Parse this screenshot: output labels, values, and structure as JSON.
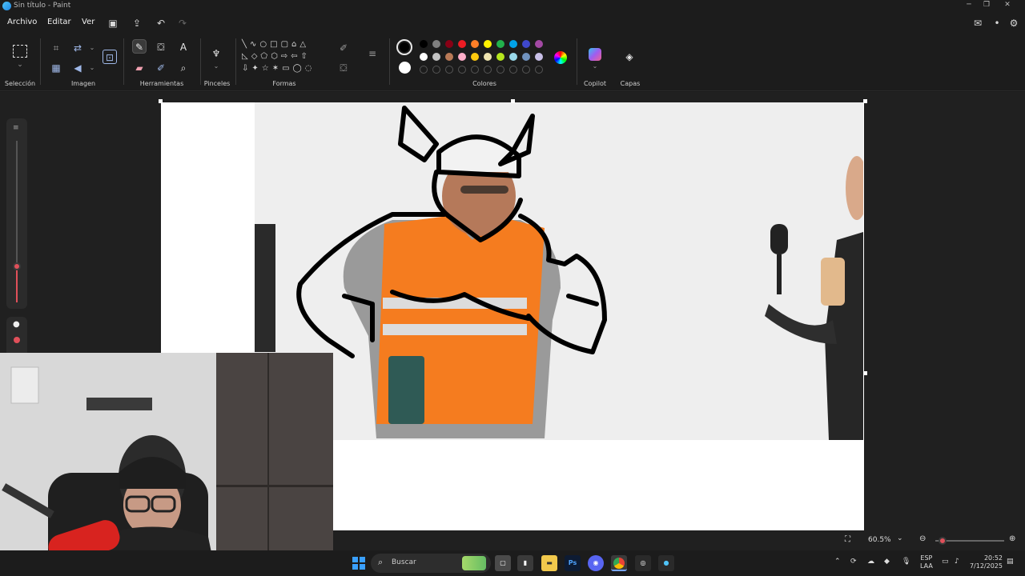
{
  "window": {
    "title": "Sin título - Paint"
  },
  "menu": {
    "items": [
      "Archivo",
      "Editar",
      "Ver"
    ]
  },
  "toolbar": {
    "groups": {
      "selection": "Selección",
      "image": "Imagen",
      "tools": "Herramientas",
      "brushes": "Pinceles",
      "shapes": "Formas",
      "colors": "Colores",
      "copilot": "Copilot",
      "layers": "Capas"
    },
    "palette_row1": [
      "#000000",
      "#7f7f7f",
      "#880015",
      "#ed1c24",
      "#ff7f27",
      "#fff200",
      "#22b14c",
      "#00a2e8",
      "#3f48cc",
      "#a349a4"
    ],
    "palette_row2": [
      "#ffffff",
      "#c3c3c3",
      "#b97a57",
      "#ffaec9",
      "#ffc90e",
      "#efe4b0",
      "#b5e61d",
      "#99d9ea",
      "#7092be",
      "#c8bfe7"
    ],
    "primary_color": "#000000",
    "secondary_color": "#ffffff"
  },
  "status": {
    "zoom": "60.5%"
  },
  "taskbar": {
    "search_placeholder": "Buscar",
    "language": "ESP",
    "language_sub": "LAA",
    "time": "20:52",
    "date": "7/12/2025"
  }
}
